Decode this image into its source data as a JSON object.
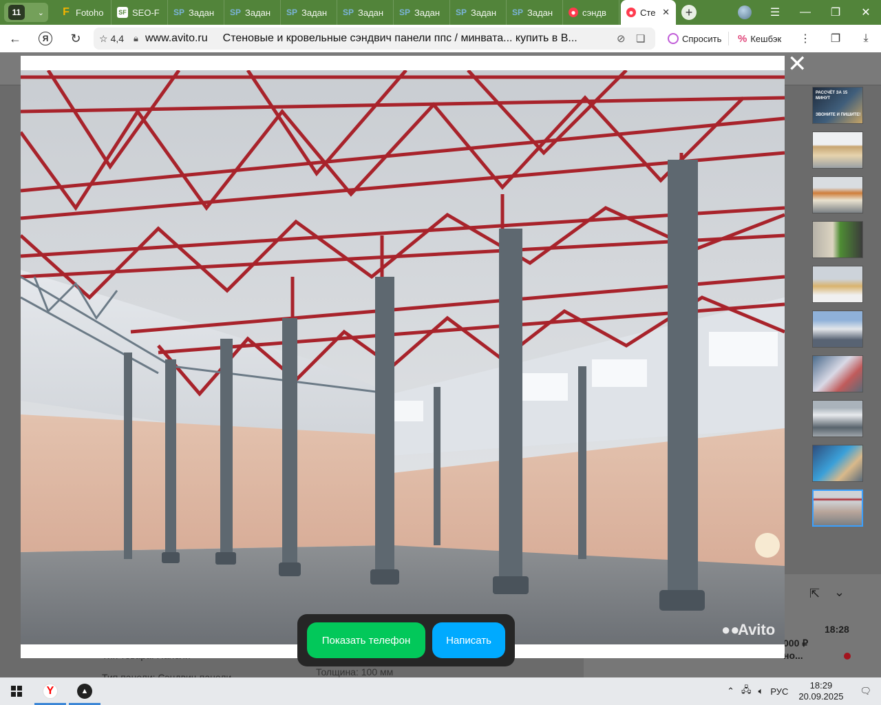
{
  "browser": {
    "tab_count": "11",
    "tabs": [
      {
        "title": "Fotoho",
        "icon": "fotohost-f-icon"
      },
      {
        "title": "SEO-F",
        "icon": "seo-sf-icon"
      },
      {
        "title": "Задан",
        "icon": "sp-icon"
      },
      {
        "title": "Задан",
        "icon": "sp-icon"
      },
      {
        "title": "Задан",
        "icon": "sp-icon"
      },
      {
        "title": "Задан",
        "icon": "sp-icon"
      },
      {
        "title": "Задан",
        "icon": "sp-icon"
      },
      {
        "title": "Задан",
        "icon": "sp-icon"
      },
      {
        "title": "Задан",
        "icon": "sp-icon"
      },
      {
        "title": "сэндв",
        "icon": "avito-icon"
      },
      {
        "title": "Сте",
        "icon": "avito-icon",
        "active": true
      }
    ],
    "rating": "4,4",
    "domain": "www.avito.ru",
    "page_title": "Стеновые и кровельные сэндвич панели ппс / минвата... купить в В...",
    "ask_label": "Спросить",
    "cashback_label": "Кешбэк"
  },
  "page": {
    "under_left": "Тип товара: Панели",
    "under_left2": "Тип панели: Сэндвич-панели",
    "thickness_label": "Толщина:",
    "thickness_value": "100 мм",
    "seller_time": "18:28",
    "seller_price": "000 ₽",
    "seller_more": "но..."
  },
  "viewer": {
    "watermark": "Avito",
    "show_phone": "Показать телефон",
    "write": "Написать",
    "first_thumb_text_1": "РАССЧЁТ ЗА 15 МИНУТ",
    "first_thumb_text_2": "ЗВОНИТЕ И ПИШИТЕ!",
    "thumbnail_count": 10,
    "active_thumbnail": 10
  },
  "taskbar": {
    "language": "РУС",
    "time": "18:29",
    "date": "20.09.2025"
  },
  "colors": {
    "tabstrip": "#52843a",
    "phone_button": "#02c85a",
    "write_button": "#00aaff",
    "truss": "#a8232b"
  }
}
